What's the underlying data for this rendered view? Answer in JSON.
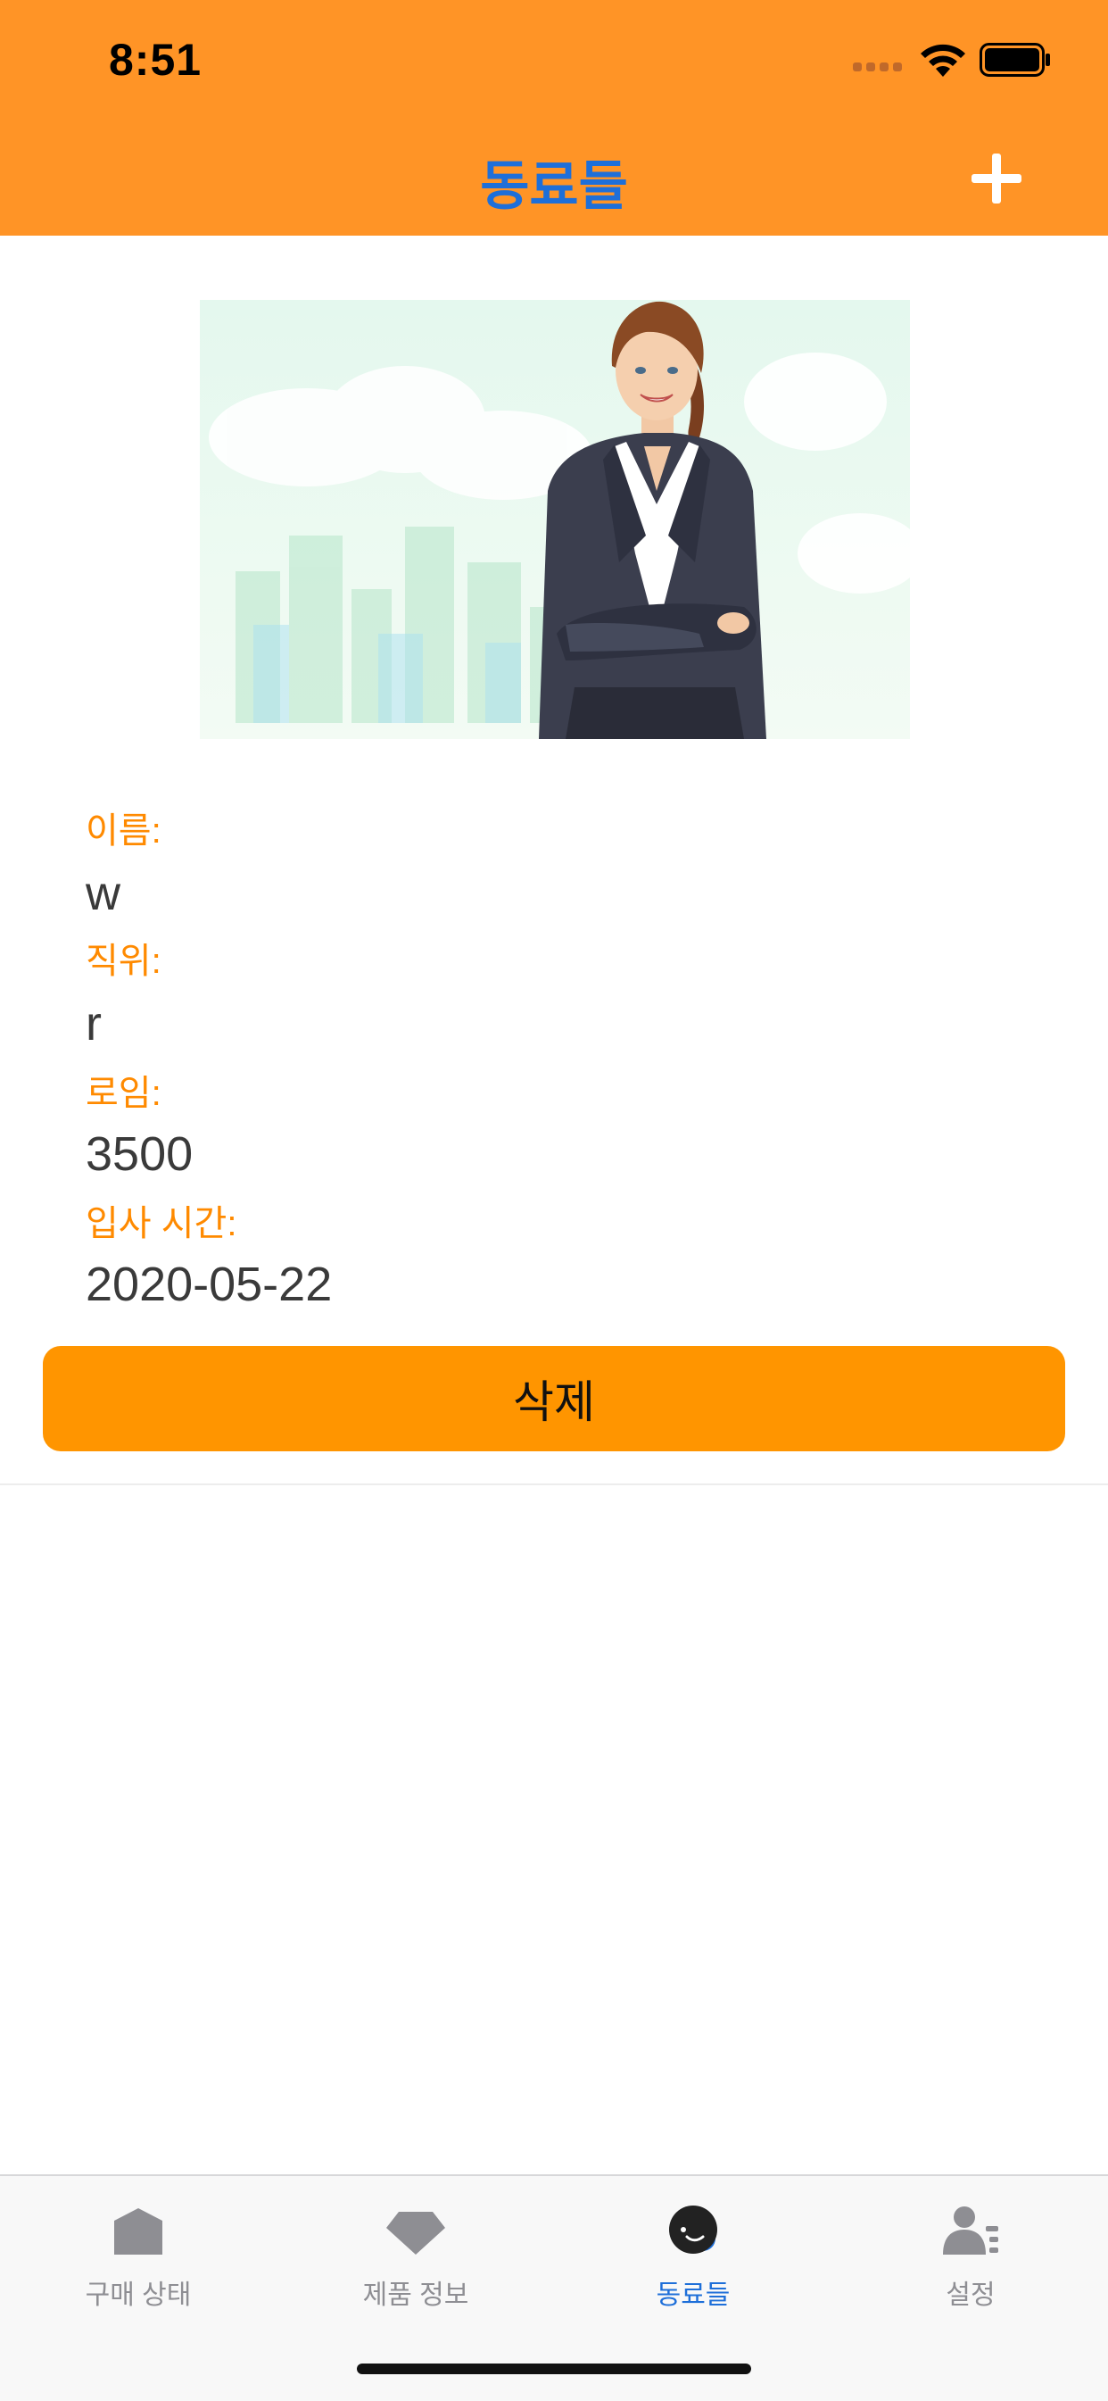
{
  "status_bar": {
    "time": "8:51"
  },
  "nav": {
    "title": "동료들"
  },
  "colleague": {
    "name_label": "이름:",
    "name_value": "w",
    "position_label": "직위:",
    "position_value": "r",
    "salary_label": "로임:",
    "salary_value": "3500",
    "join_label": "입사 시간:",
    "join_value": "2020-05-22"
  },
  "actions": {
    "delete_label": "삭제"
  },
  "tabs": [
    {
      "label": "구매 상태",
      "icon": "house-icon"
    },
    {
      "label": "제품 정보",
      "icon": "diamond-icon"
    },
    {
      "label": "동료들",
      "icon": "smiley-icon",
      "active": true
    },
    {
      "label": "설정",
      "icon": "person-card-icon"
    }
  ],
  "colors": {
    "header": "#FF9426",
    "title": "#1E6FD9",
    "label": "#FF8A00",
    "button": "#FF9500",
    "tab_inactive": "#8E8E93",
    "tab_active": "#1E6FD9"
  }
}
